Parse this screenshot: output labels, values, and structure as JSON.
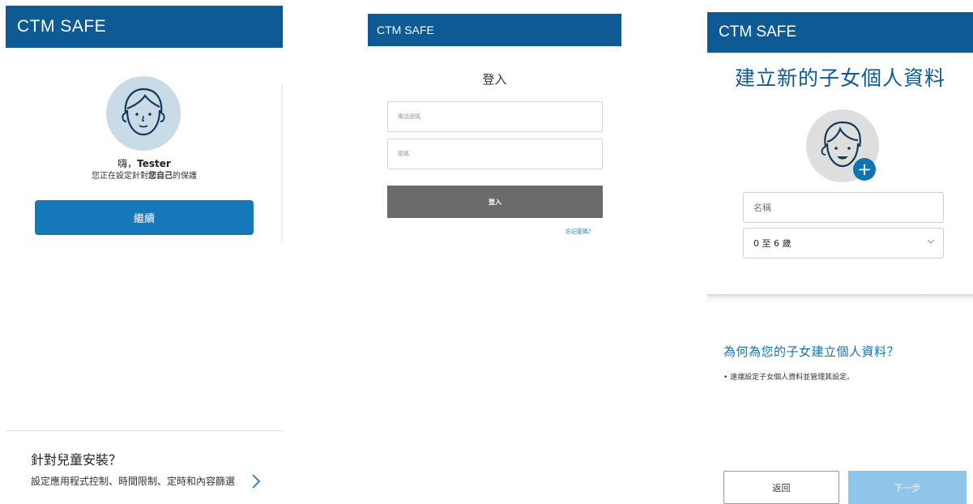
{
  "screen1": {
    "app_title": "CTM SAFE",
    "greeting_prefix": "嗨，",
    "user_name": "Tester",
    "setup_prefix": "您正在設定針對",
    "setup_bold": "您自己",
    "setup_suffix": "的保護",
    "continue_label": "繼續",
    "child_title": "針對兒童安裝？",
    "child_desc": "設定應用程式控制、時間限制、定時和內容篩選",
    "chevron_icon": "chevron-right-icon"
  },
  "screen2": {
    "app_title": "CTM SAFE",
    "title": "登入",
    "phone_placeholder": "電話號碼",
    "password_placeholder": "密碼",
    "login_label": "登入",
    "forgot_label": "忘記密碼?"
  },
  "screen3": {
    "app_title": "CTM SAFE",
    "title": "建立新的子女個人資料",
    "name_placeholder": "名稱",
    "age_selected": "0 至 6 歲",
    "why_title": "為何為您的子女建立個人資料？",
    "bullet": "• 遠端設定子女個人資料並管理其設定。",
    "back_label": "返回",
    "next_label": "下一步"
  },
  "colors": {
    "header": "#0d5a94",
    "primary_button": "#1578bb",
    "disabled_button": "#8fc5e8",
    "link": "#1a7fc1",
    "login_button": "#6b6b6b"
  }
}
